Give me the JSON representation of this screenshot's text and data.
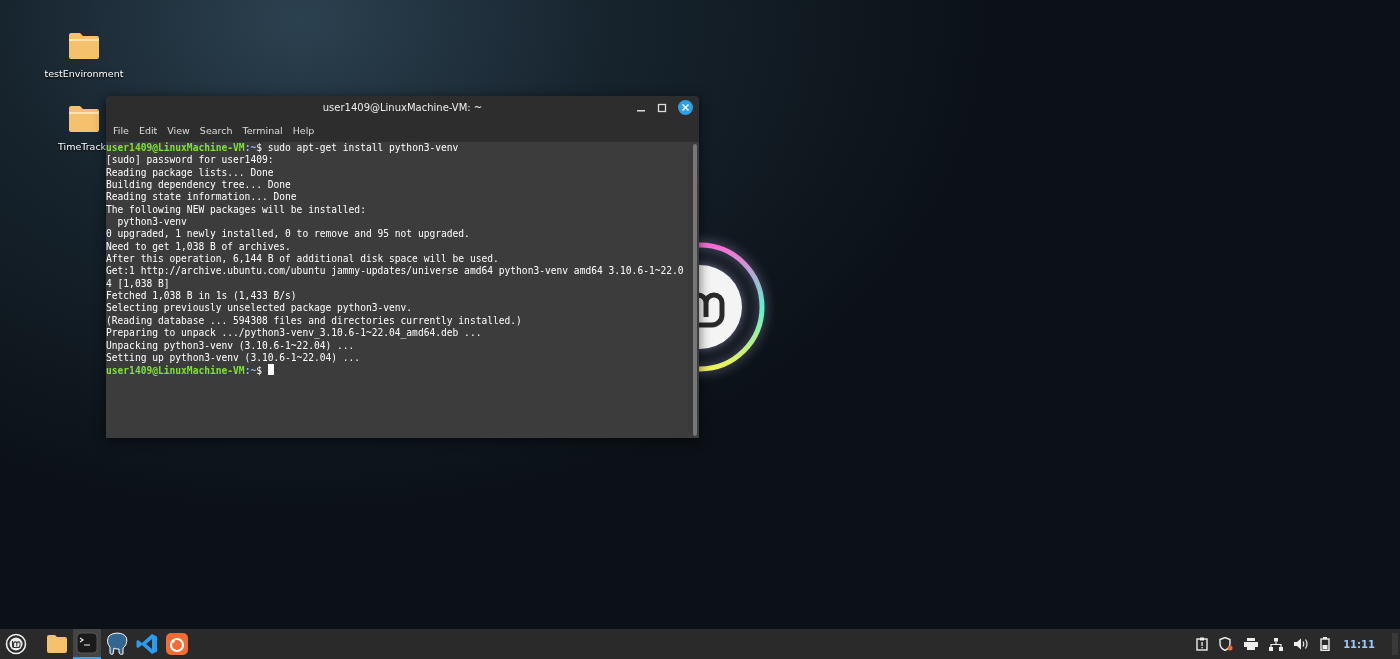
{
  "desktop_icons": [
    {
      "label": "testEnvironment"
    },
    {
      "label": "TimeTrack"
    }
  ],
  "window": {
    "title": "user1409@LinuxMachine-VM: ~",
    "menu": [
      "File",
      "Edit",
      "View",
      "Search",
      "Terminal",
      "Help"
    ],
    "lines": [
      {
        "kind": "prompt",
        "user": "user1409@LinuxMachine-VM",
        "path": ":~",
        "text": "$ sudo apt-get install python3-venv"
      },
      {
        "kind": "output",
        "text": "[sudo] password for user1409:"
      },
      {
        "kind": "output",
        "text": "Reading package lists... Done"
      },
      {
        "kind": "output",
        "text": "Building dependency tree... Done"
      },
      {
        "kind": "output",
        "text": "Reading state information... Done"
      },
      {
        "kind": "output",
        "text": "The following NEW packages will be installed:"
      },
      {
        "kind": "output",
        "text": "  python3-venv"
      },
      {
        "kind": "output",
        "text": "0 upgraded, 1 newly installed, 0 to remove and 95 not upgraded."
      },
      {
        "kind": "output",
        "text": "Need to get 1,038 B of archives."
      },
      {
        "kind": "output",
        "text": "After this operation, 6,144 B of additional disk space will be used."
      },
      {
        "kind": "output",
        "text": "Get:1 http://archive.ubuntu.com/ubuntu jammy-updates/universe amd64 python3-venv amd64 3.10.6-1~22.0"
      },
      {
        "kind": "output",
        "text": "4 [1,038 B]"
      },
      {
        "kind": "output",
        "text": "Fetched 1,038 B in 1s (1,433 B/s)"
      },
      {
        "kind": "output",
        "text": "Selecting previously unselected package python3-venv."
      },
      {
        "kind": "output",
        "text": "(Reading database ... 594308 files and directories currently installed.)"
      },
      {
        "kind": "output",
        "text": "Preparing to unpack .../python3-venv_3.10.6-1~22.04_amd64.deb ..."
      },
      {
        "kind": "output",
        "text": "Unpacking python3-venv (3.10.6-1~22.04) ..."
      },
      {
        "kind": "output",
        "text": "Setting up python3-venv (3.10.6-1~22.04) ..."
      },
      {
        "kind": "prompt",
        "user": "user1409@LinuxMachine-VM",
        "path": ":~",
        "text": "$ ",
        "cursor": true
      }
    ]
  },
  "taskbar": {
    "apps": [
      {
        "kind": "folder",
        "selected": false
      },
      {
        "kind": "terminal",
        "selected": true
      },
      {
        "kind": "elephant",
        "selected": false
      },
      {
        "kind": "code",
        "selected": false
      },
      {
        "kind": "browser",
        "selected": false
      }
    ],
    "clock": "11:11"
  }
}
